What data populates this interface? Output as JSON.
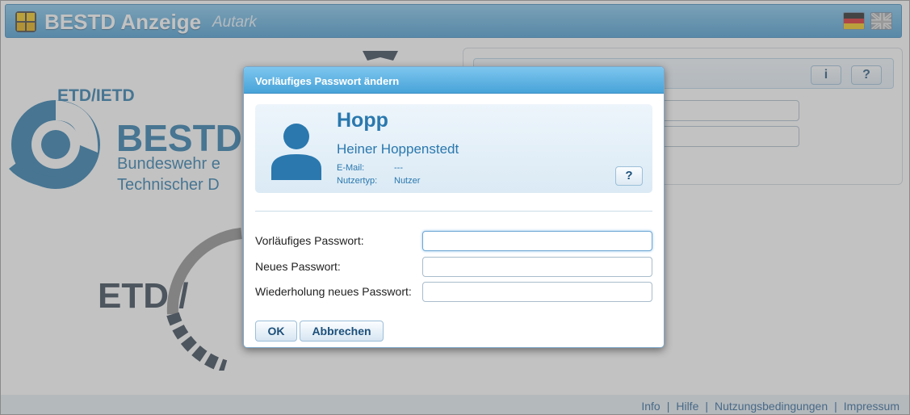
{
  "header": {
    "title": "BESTD Anzeige",
    "subtitle": "Autark"
  },
  "languages": [
    {
      "code": "de",
      "icon": "german-flag-icon"
    },
    {
      "code": "en",
      "icon": "uk-flag-icon"
    }
  ],
  "background": {
    "logo_top_text": "ETD/IETD",
    "logo_big_text": "BESTD",
    "logo_line1": "Bundeswehr e",
    "logo_line2": "Technischer D",
    "logo_lower_text": "ETD /",
    "info_button": "i",
    "help_button": "?"
  },
  "footer": {
    "links": [
      "Info",
      "Hilfe",
      "Nutzungsbedingungen",
      "Impressum"
    ],
    "separator": "|"
  },
  "dialog": {
    "title": "Vorläufiges Passwort ändern",
    "user": {
      "short_name": "Hopp",
      "full_name": "Heiner Hoppenstedt",
      "email_label": "E-Mail:",
      "email_value": "---",
      "type_label": "Nutzertyp:",
      "type_value": "Nutzer"
    },
    "help_button": "?",
    "fields": {
      "temp_password": {
        "label": "Vorläufiges Passwort:",
        "value": ""
      },
      "new_password": {
        "label": "Neues Passwort:",
        "value": ""
      },
      "repeat_password": {
        "label": "Wiederholung neues Passwort:",
        "value": ""
      }
    },
    "ok_label": "OK",
    "cancel_label": "Abbrechen"
  },
  "colors": {
    "accent": "#2a78ae",
    "header_top": "#7cc2ea",
    "header_bottom": "#3f97cf",
    "logo_blue": "#1f73a8",
    "logo_dark": "#2b3a4a"
  }
}
